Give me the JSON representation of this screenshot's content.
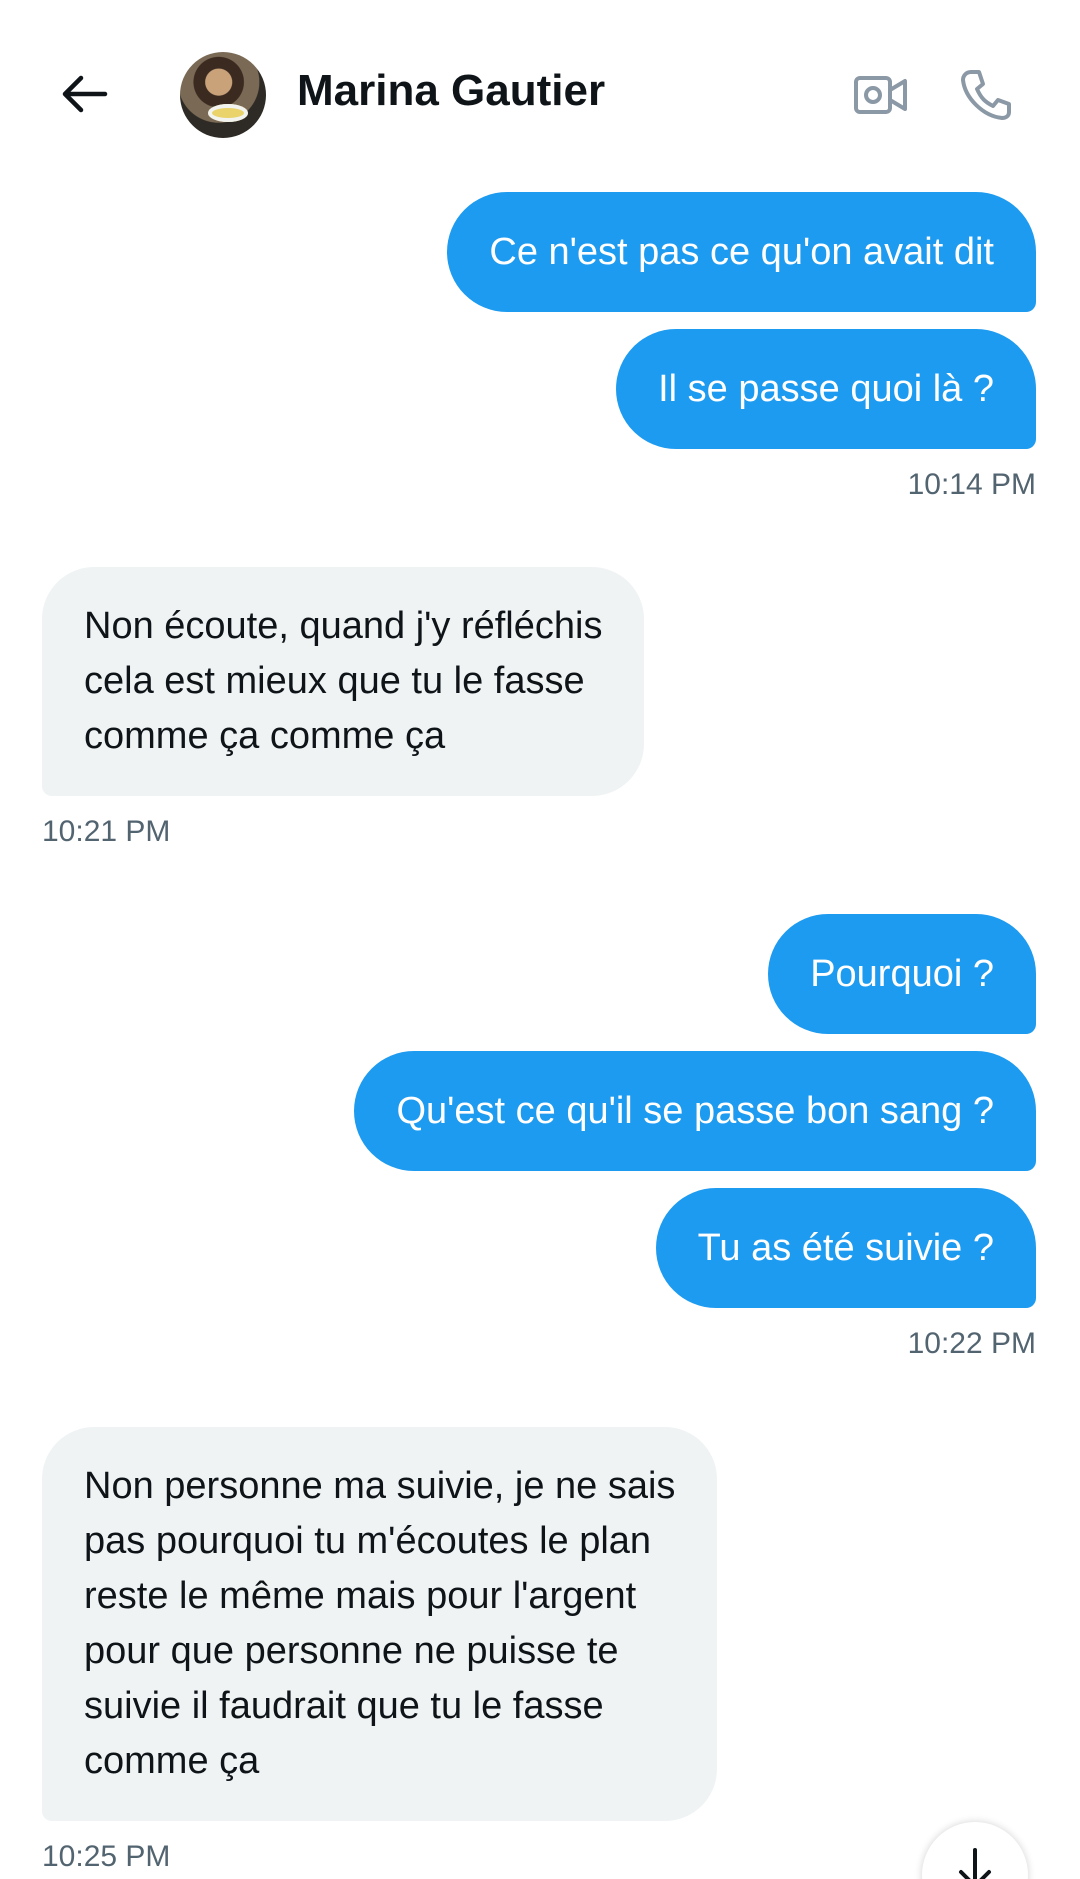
{
  "header": {
    "contact_name": "Marina Gautier",
    "back_icon": "arrow-left-icon",
    "video_icon": "video-camera-icon",
    "phone_icon": "phone-icon"
  },
  "messages": [
    {
      "direction": "sent",
      "text": "Ce n'est pas ce qu'on avait dit"
    },
    {
      "direction": "sent",
      "text": "Il se passe quoi là ?"
    },
    {
      "timestamp": "10:14 PM"
    },
    {
      "direction": "received",
      "lines": [
        "Non écoute, quand j'y réfléchis",
        "cela est mieux que tu le fasse",
        "comme ça comme ça"
      ]
    },
    {
      "timestamp": "10:21 PM"
    },
    {
      "direction": "sent",
      "text": "Pourquoi ?"
    },
    {
      "direction": "sent",
      "text": "Qu'est ce qu'il se passe bon sang ?"
    },
    {
      "direction": "sent",
      "text": "Tu as été suivie ?"
    },
    {
      "timestamp": "10:22 PM"
    },
    {
      "direction": "received",
      "lines": [
        "Non personne ma suivie,  je ne sais",
        "pas pourquoi tu m'écoutes le plan",
        "reste le même mais pour l'argent",
        "pour que personne ne puisse te",
        "suivie il faudrait que tu le fasse",
        "comme ça"
      ]
    },
    {
      "timestamp": "10:25 PM"
    }
  ],
  "scroll_button": {
    "icon": "arrow-down-icon"
  },
  "colors": {
    "sent_bubble": "#1d9bf0",
    "received_bubble": "#eff3f4",
    "timestamp": "#536471",
    "icon_gray": "#8b98a5"
  }
}
